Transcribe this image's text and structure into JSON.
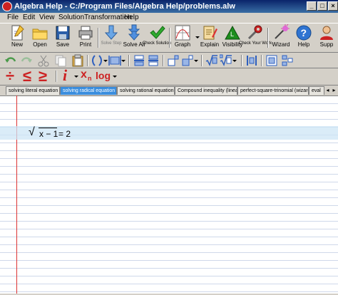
{
  "window": {
    "title": "Algebra Help - C:/Program Files/Algebra Help/problems.alw"
  },
  "menu": {
    "items": [
      "File",
      "Edit",
      "View",
      "Solution",
      "Transformation",
      "Help"
    ]
  },
  "toolbar": {
    "new": "New",
    "open": "Open",
    "save": "Save",
    "print": "Print",
    "solve_step": "Solve Step",
    "solve_all": "Solve All",
    "check_solution": "Check Solution",
    "graph": "Graph",
    "explain": "Explain",
    "visibility": "Visibility",
    "check_your_work": "Check Your Work",
    "wizard": "Wizard",
    "help": "Help",
    "support": "Supp"
  },
  "math_toolbar": {
    "divide": "÷",
    "less_equal": "≤",
    "greater_equal": "≥",
    "italic": "i",
    "subscript_x": "x",
    "subscript_n": "n",
    "log": "log"
  },
  "tabs": [
    {
      "label": "solving literal equation",
      "active": false
    },
    {
      "label": "solving radical equation",
      "active": true
    },
    {
      "label": "solving rational equation",
      "active": false
    },
    {
      "label": "Compound inequality (linear)",
      "active": false
    },
    {
      "label": "perfect-square-trinomial (wizard)",
      "active": false
    },
    {
      "label": "eval",
      "active": false
    }
  ],
  "document": {
    "equation": {
      "radical": "√",
      "radicand": "x − 1",
      "rhs": "= 2"
    }
  },
  "colors": {
    "title_bar": "#0a246a",
    "active_tab": "#3b8ede",
    "margin_line": "#dd3333",
    "rule_line": "#cfd8ea"
  }
}
